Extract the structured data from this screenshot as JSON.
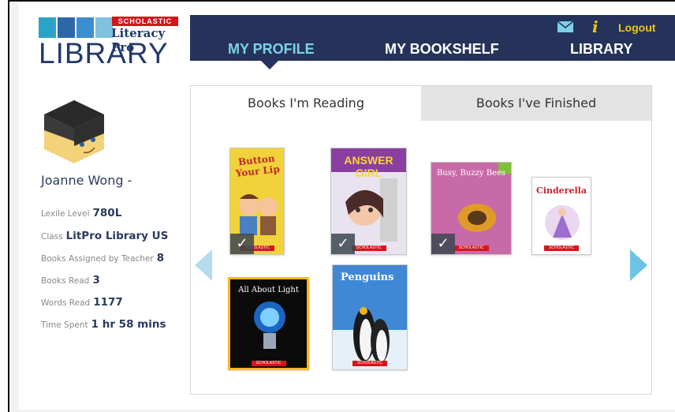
{
  "logo": {
    "publisher": "SCHOLASTIC",
    "product": "Literacy Pro",
    "library": "LIBRARY"
  },
  "nav": {
    "tabs": [
      {
        "label": "MY PROFILE",
        "active": true
      },
      {
        "label": "MY BOOKSHELF",
        "active": false
      },
      {
        "label": "LIBRARY",
        "active": false
      }
    ],
    "logout": "Logout",
    "mail_icon": "mail-icon",
    "info_icon": "info-icon",
    "info_glyph": "i"
  },
  "profile": {
    "name": "Joanne Wong -",
    "stats": [
      {
        "label": "Lexile Level",
        "value": "780L"
      },
      {
        "label": "Class",
        "value": "LitPro Library US"
      },
      {
        "label": "Books Assigned by Teacher",
        "value": "8"
      },
      {
        "label": "Books Read",
        "value": "3"
      },
      {
        "label": "Words Read",
        "value": "1177"
      },
      {
        "label": "Time Spent",
        "value": "1 hr 58 mins"
      }
    ]
  },
  "panel": {
    "tabs": [
      {
        "label": "Books I'm Reading",
        "active": true
      },
      {
        "label": "Books I've Finished",
        "active": false
      }
    ]
  },
  "books": [
    {
      "title": "Button Your Lip",
      "finished": true
    },
    {
      "title": "ANSWER GIRL",
      "finished": true
    },
    {
      "title": "Busy, Buzzy Bees",
      "finished": true
    },
    {
      "title": "Cinderella",
      "finished": false
    },
    {
      "title": "All About Light",
      "finished": false
    },
    {
      "title": "Penguins",
      "finished": false
    }
  ],
  "colors": {
    "nav_bg": "#25335a",
    "nav_active": "#7fd0ea",
    "accent_yellow": "#f0c419",
    "text_dark": "#2a3b5e"
  }
}
